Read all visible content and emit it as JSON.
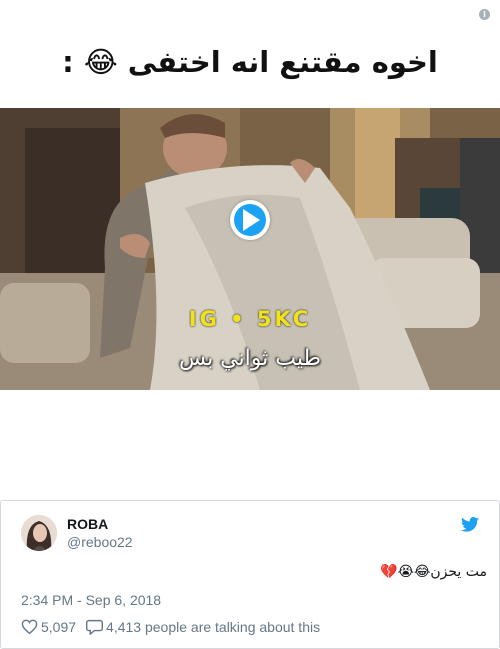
{
  "headline": {
    "text": "اخوه مقتنع انه اختفى 😂 :"
  },
  "video": {
    "ig_caption": "IG • 5KC",
    "arabic_caption": "طيب ثواني بس",
    "play_icon": "play-icon"
  },
  "tweet": {
    "name": "ROBA",
    "handle": "@reboo22",
    "text": "مت يحزن😂😭💔",
    "timestamp": "2:34 PM - Sep 6, 2018",
    "likes": "5,097",
    "replies_text": "4,413 people are talking about this"
  },
  "colors": {
    "twitter_blue": "#1da1f2",
    "caption_yellow": "#f2e21a",
    "secondary_text": "#657786"
  }
}
